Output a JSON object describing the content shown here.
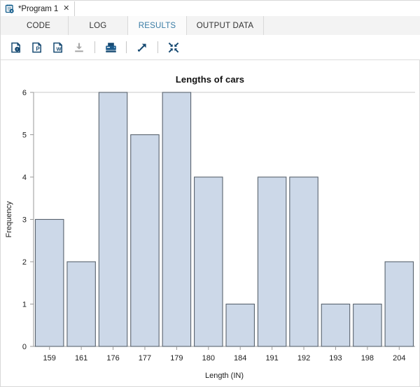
{
  "window": {
    "tab": {
      "icon": "sas-program-icon",
      "label": "*Program 1",
      "close": "✕"
    }
  },
  "view_tabs": [
    {
      "label": "CODE",
      "active": false
    },
    {
      "label": "LOG",
      "active": false
    },
    {
      "label": "RESULTS",
      "active": true
    },
    {
      "label": "OUTPUT DATA",
      "active": false
    }
  ],
  "toolbar": {
    "buttons": [
      {
        "name": "export-html-icon",
        "label": "Open in HTML",
        "enabled": true
      },
      {
        "name": "export-pdf-icon",
        "label": "Open in PDF",
        "enabled": true
      },
      {
        "name": "export-word-icon",
        "label": "Open in Word",
        "enabled": true
      },
      {
        "name": "download-icon",
        "label": "Download results",
        "enabled": false
      },
      {
        "name": "print-icon",
        "label": "Print",
        "enabled": true
      },
      {
        "name": "open-new-window-icon",
        "label": "Open in new window",
        "enabled": true
      },
      {
        "name": "collapse-icon",
        "label": "Minimize view",
        "enabled": true
      }
    ]
  },
  "chart_data": {
    "type": "bar",
    "title": "Lengths of cars",
    "xlabel": "Length (IN)",
    "ylabel": "Frequency",
    "categories": [
      "159",
      "161",
      "176",
      "177",
      "179",
      "180",
      "184",
      "191",
      "192",
      "193",
      "198",
      "204"
    ],
    "values": [
      3,
      2,
      6,
      5,
      6,
      4,
      1,
      4,
      4,
      1,
      1,
      2
    ],
    "yticks": [
      0,
      1,
      2,
      3,
      4,
      5,
      6
    ],
    "ylim": [
      0,
      6
    ],
    "grid": false,
    "legend": null,
    "colors": {
      "bar_fill": "#ccd8e8",
      "bar_stroke": "#59636e",
      "axis": "#9a9a9a",
      "text": "#1c1c1c",
      "accent": "#3a7ca5"
    }
  }
}
